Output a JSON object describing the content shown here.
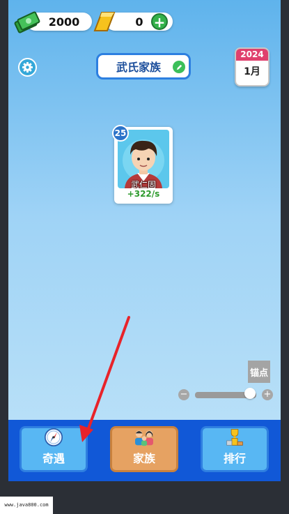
{
  "top_bar": {
    "money": "2000",
    "gold": "0",
    "plus_label": "+"
  },
  "family": {
    "title": "武氏家族"
  },
  "calendar": {
    "year": "2024",
    "month": "1月"
  },
  "character": {
    "level": "25",
    "name": "武仁固",
    "rate": "+322/s"
  },
  "controls": {
    "anchor_label": "锚点",
    "zoom_minus": "−",
    "zoom_plus": "+",
    "zoom_level": 0.9
  },
  "nav": {
    "items": [
      {
        "label": "奇遇",
        "icon": "compass-icon"
      },
      {
        "label": "家族",
        "icon": "family-icon"
      },
      {
        "label": "排行",
        "icon": "trophy-podium-icon"
      }
    ]
  },
  "watermark": "www.java800.com",
  "colors": {
    "accent_blue": "#1158d7",
    "pink_year": "#e0406d",
    "green_rate": "#2e9b2e",
    "arrow_red": "#e8232a"
  }
}
